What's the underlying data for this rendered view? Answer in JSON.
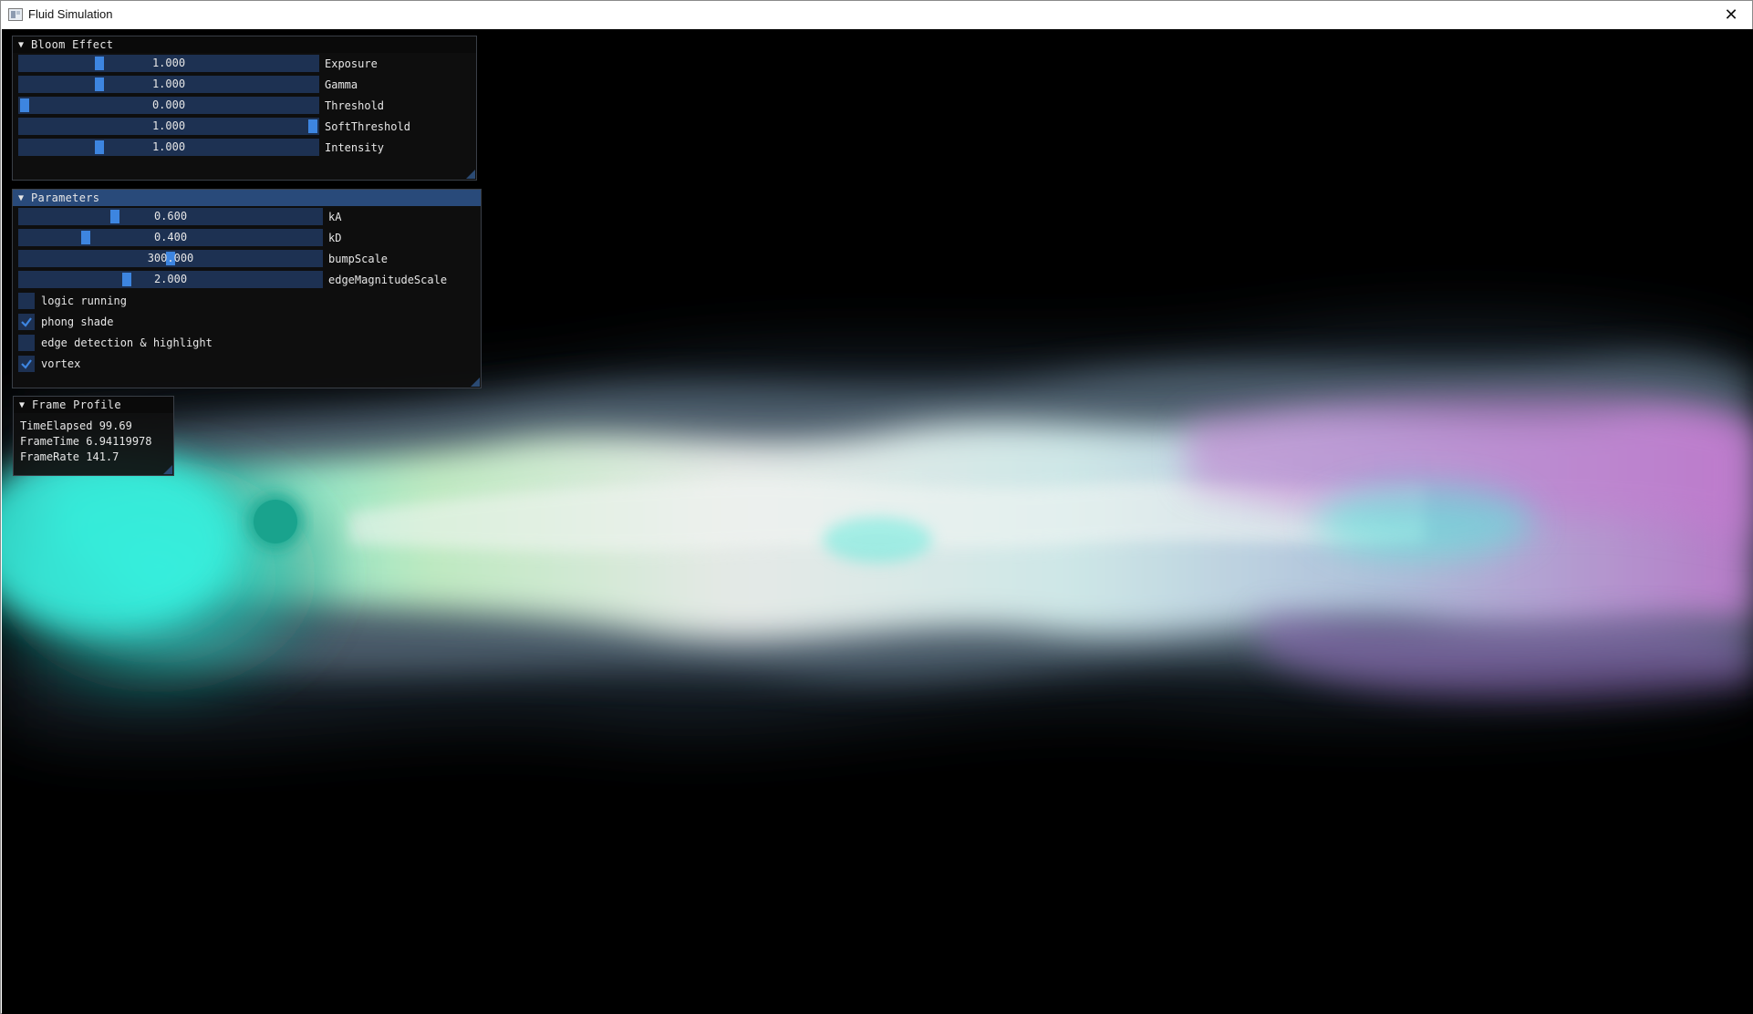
{
  "window": {
    "title": "Fluid Simulation",
    "close_glyph": "✕",
    "icon": "app-window-icon"
  },
  "bloom": {
    "title": "Bloom Effect",
    "sliders": [
      {
        "label": "Exposure",
        "value": "1.000",
        "fraction": 0.26
      },
      {
        "label": "Gamma",
        "value": "1.000",
        "fraction": 0.26
      },
      {
        "label": "Threshold",
        "value": "0.000",
        "fraction": 0.0
      },
      {
        "label": "SoftThreshold",
        "value": "1.000",
        "fraction": 1.0
      },
      {
        "label": "Intensity",
        "value": "1.000",
        "fraction": 0.26
      }
    ]
  },
  "parameters": {
    "title": "Parameters",
    "sliders": [
      {
        "label": "kA",
        "value": "0.600",
        "fraction": 0.31
      },
      {
        "label": "kD",
        "value": "0.400",
        "fraction": 0.21
      },
      {
        "label": "bumpScale",
        "value": "300.000",
        "fraction": 0.5
      },
      {
        "label": "edgeMagnitudeScale",
        "value": "2.000",
        "fraction": 0.35
      }
    ],
    "checkboxes": [
      {
        "label": "logic running",
        "checked": false
      },
      {
        "label": "phong shade",
        "checked": true
      },
      {
        "label": "edge detection & highlight",
        "checked": false
      },
      {
        "label": "vortex",
        "checked": true
      }
    ]
  },
  "profile": {
    "title": "Frame Profile",
    "lines": [
      "TimeElapsed 99.69",
      "FrameTime 6.94119978",
      "FrameRate 141.7"
    ]
  },
  "colors": {
    "slider_bg": "#1d3152",
    "slider_grab": "#3d85e0",
    "header_active": "#294a7a",
    "fluid_cyan": "#38f0e0",
    "fluid_magenta": "#c27fd0"
  }
}
